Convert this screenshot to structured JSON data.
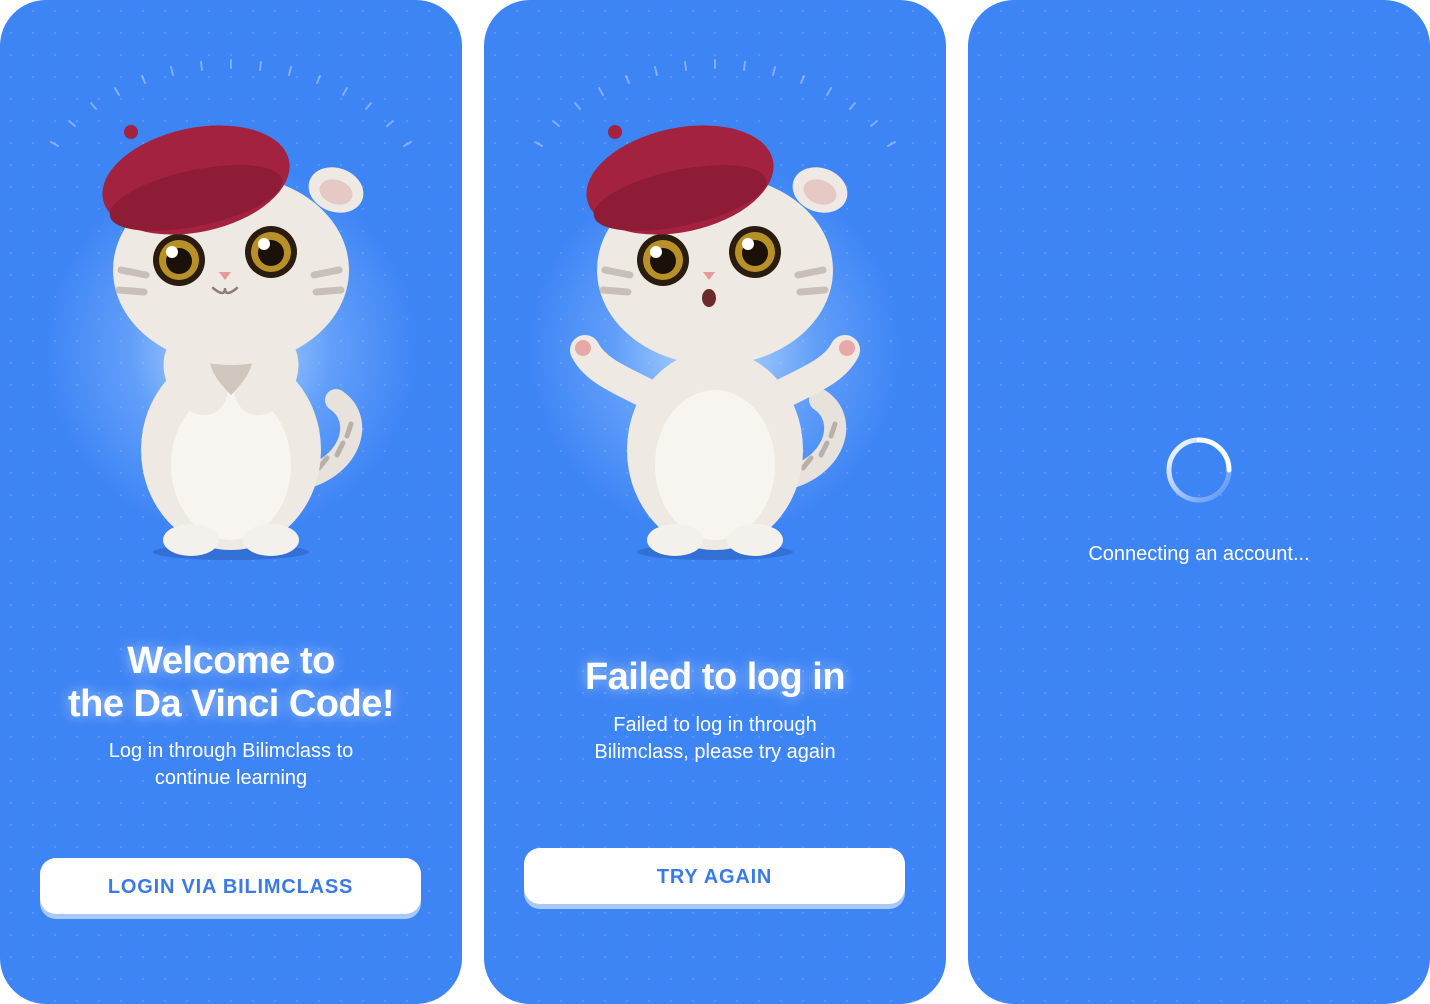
{
  "screens": {
    "welcome": {
      "title_line1": "Welcome to",
      "title_line2": "the Da Vinci Code!",
      "subtitle_line1": "Log in through Bilimclass to",
      "subtitle_line2": "continue learning",
      "button_label": "LOGIN VIA BILIMCLASS",
      "mascot": "cat-beret-heart-hands"
    },
    "failed": {
      "title": "Failed to log in",
      "subtitle_line1": "Failed to log in through",
      "subtitle_line2": "Bilimclass, please try again",
      "button_label": "TRY AGAIN",
      "mascot": "cat-beret-shrug"
    },
    "loading": {
      "status_text": "Connecting an account...",
      "icon": "spinner-icon"
    }
  },
  "colors": {
    "background": "#3d84f5",
    "button": "#ffffff",
    "button_text": "#3b79e6",
    "button_shadow": "#a9c8f8",
    "beret": "#a3223f"
  }
}
